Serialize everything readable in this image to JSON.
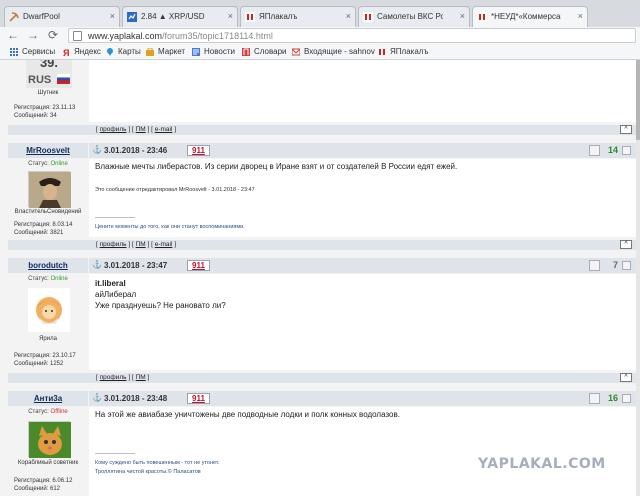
{
  "tabs": [
    {
      "label": "DwarfPool",
      "icon": "pickaxe-icon",
      "color": "#c08030"
    },
    {
      "label": "2.84 ▲ XRP/USD",
      "icon": "chart-icon",
      "color": "#2a6ac0"
    },
    {
      "label": "ЯПлакалъ",
      "icon": "yaplakal-icon",
      "color": "#d02020"
    },
    {
      "label": "Самолеты ВКС России п",
      "icon": "yaplakal-icon",
      "color": "#d02020"
    },
    {
      "label": "*НЕУД*«Коммерсантъ» н",
      "icon": "yaplakal-icon",
      "color": "#d02020"
    }
  ],
  "tab_close": "×",
  "nav": {
    "back": "←",
    "forward": "→",
    "reload": "⟳"
  },
  "address": {
    "domain": "www.yaplakal.com",
    "path": "/forum35/topic1718114.html"
  },
  "bookmarks": [
    {
      "label": "Сервисы",
      "icon": "apps-icon",
      "color": "#3a6fd8"
    },
    {
      "label": "Яндекс",
      "icon": "yandex-icon",
      "color": "#e02020"
    },
    {
      "label": "Карты",
      "icon": "map-icon",
      "color": "#2a90d8"
    },
    {
      "label": "Маркет",
      "icon": "market-icon",
      "color": "#e0a020"
    },
    {
      "label": "Новости",
      "icon": "news-icon",
      "color": "#4a7ad8"
    },
    {
      "label": "Словари",
      "icon": "dict-icon",
      "color": "#d04040"
    },
    {
      "label": "Входящие - sahnov",
      "icon": "mail-icon",
      "color": "#d04040"
    },
    {
      "label": "ЯПлакалъ",
      "icon": "yaplakal-icon",
      "color": "#d02020"
    }
  ],
  "first_post": {
    "user_title": "Шутник",
    "reg": "Регистрация: 23.11.13",
    "msgs": "Сообщений: 34",
    "avatar_text_top": "39.",
    "avatar_text": "RUS"
  },
  "links_full": {
    "profile": "профиль",
    "pm": "ПМ",
    "email": "e-mail",
    "top": "^"
  },
  "links_short": {
    "profile": "профиль",
    "pm": "ПМ"
  },
  "posts": [
    {
      "author": "MrRoosvelt",
      "status_label": "Статус:",
      "status": "Online",
      "user_title": "ВластительСновидений",
      "reg": "Регистрация: 8.03.14",
      "msgs": "Сообщений: 3821",
      "date": "3.01.2018 - 23:46",
      "num": "911",
      "rating": "14",
      "text": "Влажные мечты либерастов. Из серии дворец в Иране взят и от создателей В России едят ежей.",
      "edited": "Это сообщение отредактировал MrRoosvelt - 3.01.2018 - 23:47",
      "sig_line": "--------------------",
      "sig": "Цените моменты до того, как они станут воспоминаниями."
    },
    {
      "author": "borodutch",
      "status_label": "Статус:",
      "status": "Online",
      "user_title": "Ярила",
      "reg": "Регистрация: 23.10.17",
      "msgs": "Сообщений: 1252",
      "date": "3.01.2018 - 23:47",
      "num": "911",
      "rating": "7",
      "line1": "it.liberal",
      "line2": "айЛиберал",
      "line3": "Уже празднуешь? Не рановато ли?"
    },
    {
      "author": "Анти3а",
      "status_label": "Статус:",
      "status": "Offline",
      "user_title": "Корабликый советник",
      "reg": "Регистрация: 6.06.12",
      "msgs": "Сообщений: 612",
      "date": "3.01.2018 - 23:48",
      "num": "911",
      "rating": "16",
      "text": "На этой же авиабазе уничтожены две подводные лодки и полк конных водолазов.",
      "sig_line": "--------------------",
      "sig1": "Кому суждено быть повешенным - тот не утонет.",
      "sig2": "Троллятина чистой красоты.© Паласатов"
    }
  ],
  "watermark": "YAPLAKAL.COM",
  "colors": {
    "online": "#2a9a2a",
    "offline": "#d03030",
    "post_num": "#c0102a",
    "header_bg": "#dfe4ea"
  }
}
